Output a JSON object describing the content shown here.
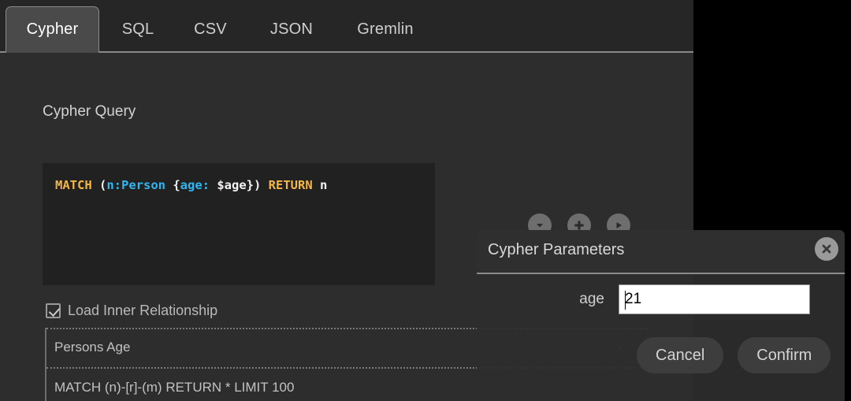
{
  "tabs": [
    {
      "label": "Cypher",
      "active": true
    },
    {
      "label": "SQL",
      "active": false
    },
    {
      "label": "CSV",
      "active": false
    },
    {
      "label": "JSON",
      "active": false
    },
    {
      "label": "Gremlin",
      "active": false
    }
  ],
  "editor": {
    "section_label": "Cypher Query",
    "query_plain": "MATCH (n:Person {age: $age}) RETURN n",
    "tokens": [
      {
        "text": "MATCH",
        "kind": "keyword"
      },
      {
        "text": " (",
        "kind": "plain"
      },
      {
        "text": "n:Person",
        "kind": "ident"
      },
      {
        "text": " {",
        "kind": "plain"
      },
      {
        "text": "age:",
        "kind": "ident"
      },
      {
        "text": " $age}) ",
        "kind": "plain"
      },
      {
        "text": "RETURN",
        "kind": "keyword"
      },
      {
        "text": " n",
        "kind": "plain"
      }
    ],
    "colors": {
      "keyword": "#f5b642",
      "identifier": "#30b6f0",
      "plain": "#f2f2f2",
      "background": "#212121"
    }
  },
  "toolbar": {
    "buttons": [
      {
        "icon": "chevron-down-icon",
        "name": "collapse"
      },
      {
        "icon": "plus-icon",
        "name": "add"
      },
      {
        "icon": "play-icon",
        "name": "run"
      }
    ]
  },
  "options": {
    "load_inner_relationship": {
      "label": "Load Inner Relationship",
      "checked": true
    }
  },
  "saved_queries": [
    {
      "title": "Persons Age",
      "delete_label": "×"
    },
    {
      "title": "MATCH (n)-[r]-(m) RETURN * LIMIT 100",
      "delete_label": ""
    }
  ],
  "dialog": {
    "title": "Cypher Parameters",
    "close_label": "✕",
    "parameters": [
      {
        "name": "age",
        "value": "21",
        "placeholder": ""
      }
    ],
    "cancel_label": "Cancel",
    "confirm_label": "Confirm"
  }
}
